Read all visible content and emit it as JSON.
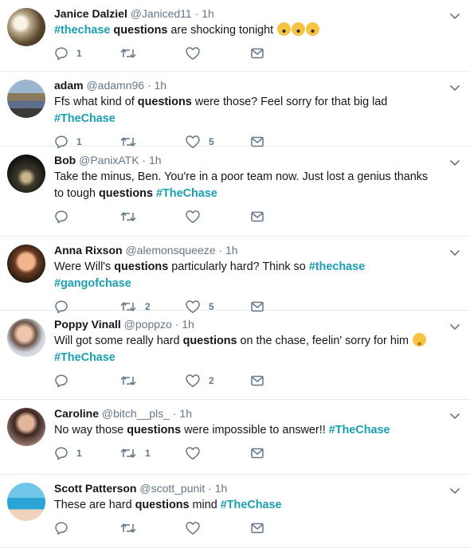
{
  "tweets": [
    {
      "name": "Janice Dalziel",
      "handle": "@Janiced11",
      "time": "1h",
      "segments": [
        {
          "t": "#thechase",
          "k": "tag"
        },
        {
          "t": " "
        },
        {
          "t": "questions",
          "k": "kw"
        },
        {
          "t": " are shocking tonight "
        }
      ],
      "emoji": "scream-emoji x3",
      "replies": "1",
      "retweets": "",
      "likes": ""
    },
    {
      "name": "adam",
      "handle": "@adamn96",
      "time": "1h",
      "segments": [
        {
          "t": "Ffs what kind of "
        },
        {
          "t": "questions",
          "k": "kw"
        },
        {
          "t": " were those? Feel sorry for that big lad "
        },
        {
          "t": "#TheChase",
          "k": "tag"
        }
      ],
      "replies": "1",
      "retweets": "",
      "likes": "5"
    },
    {
      "name": "Bob",
      "handle": "@PanixATK",
      "time": "1h",
      "segments": [
        {
          "t": "Take the minus, Ben. You're in a poor team now. Just lost a genius thanks to tough "
        },
        {
          "t": "questions",
          "k": "kw"
        },
        {
          "t": " "
        },
        {
          "t": "#TheChase",
          "k": "tag"
        }
      ],
      "replies": "",
      "retweets": "",
      "likes": ""
    },
    {
      "name": "Anna Rixson",
      "handle": "@alemonsqueeze",
      "time": "1h",
      "segments": [
        {
          "t": "Were Will's "
        },
        {
          "t": "questions",
          "k": "kw"
        },
        {
          "t": " particularly hard? Think so "
        },
        {
          "t": "#thechase",
          "k": "tag"
        },
        {
          "t": " "
        },
        {
          "t": "#gangofchase",
          "k": "tag"
        }
      ],
      "replies": "",
      "retweets": "2",
      "likes": "5"
    },
    {
      "name": "Poppy Vinall",
      "handle": "@poppzo",
      "time": "1h",
      "segments": [
        {
          "t": "Will got some really hard "
        },
        {
          "t": "questions",
          "k": "kw"
        },
        {
          "t": " on the chase, feelin' sorry for him "
        }
      ],
      "emoji": "frown-emoji",
      "tail_tag": "#TheChase",
      "replies": "",
      "retweets": "",
      "likes": "2"
    },
    {
      "name": "Caroline",
      "handle": "@bitch__pls_",
      "time": "1h",
      "segments": [
        {
          "t": "No way those "
        },
        {
          "t": "questions",
          "k": "kw"
        },
        {
          "t": " were impossible to answer!! "
        },
        {
          "t": "#TheChase",
          "k": "tag"
        }
      ],
      "replies": "1",
      "retweets": "1",
      "likes": ""
    },
    {
      "name": "Scott Patterson",
      "handle": "@scott_punit",
      "time": "1h",
      "segments": [
        {
          "t": "These are hard "
        },
        {
          "t": "questions",
          "k": "kw"
        },
        {
          "t": " mind "
        },
        {
          "t": "#TheChase",
          "k": "tag"
        }
      ],
      "replies": "",
      "retweets": "",
      "likes": ""
    }
  ],
  "colors": {
    "hashtag": "#1da1f2",
    "muted": "#657786",
    "divider": "#e6ecf0"
  },
  "icons": {
    "reply": "reply-icon",
    "retweet": "retweet-icon",
    "like": "heart-icon",
    "dm": "envelope-icon",
    "menu": "chevron-down-icon"
  }
}
